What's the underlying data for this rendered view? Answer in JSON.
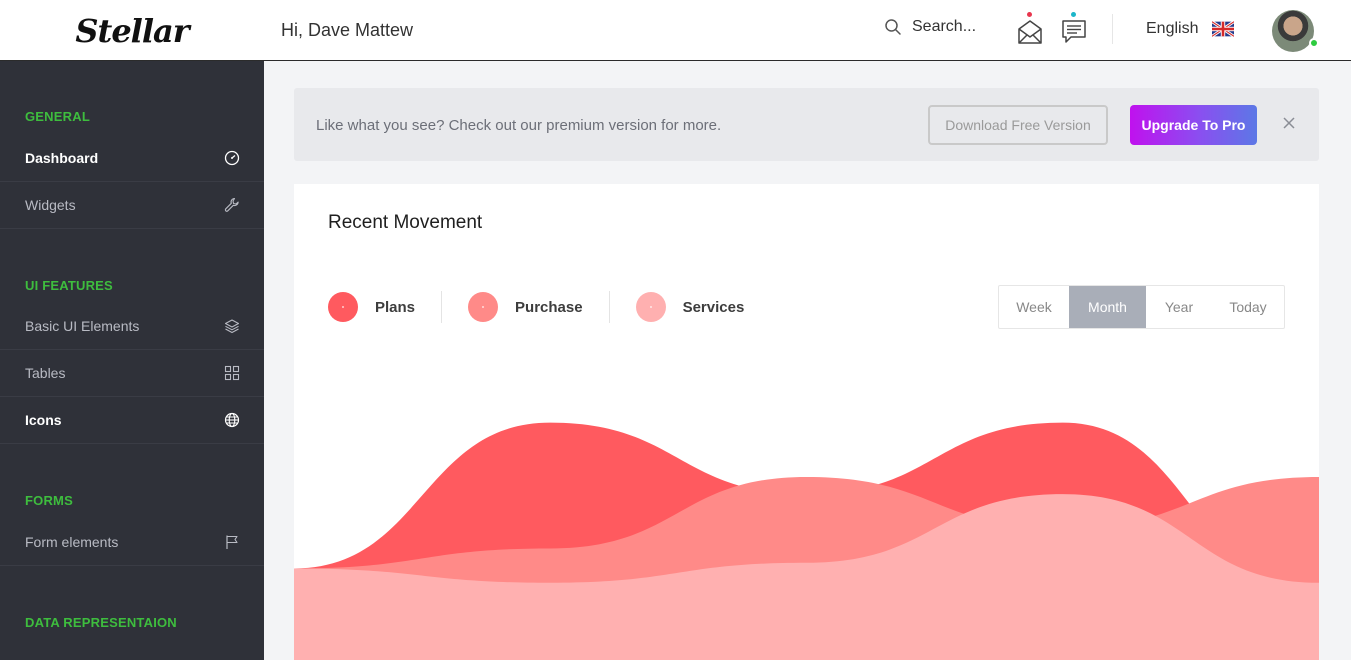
{
  "brand": {
    "name": "Stellar"
  },
  "header": {
    "greeting": "Hi, Dave Mattew",
    "search_placeholder": "Search...",
    "language": "English",
    "mail_dot_color": "#e8364e",
    "chat_dot_color": "#1cb6c9"
  },
  "sidebar": {
    "sections": [
      {
        "title": "GENERAL",
        "items": [
          {
            "label": "Dashboard",
            "icon": "speedometer-icon",
            "active": true
          },
          {
            "label": "Widgets",
            "icon": "wrench-icon",
            "active": false
          }
        ]
      },
      {
        "title": "UI FEATURES",
        "items": [
          {
            "label": "Basic UI Elements",
            "icon": "layers-icon",
            "active": false
          },
          {
            "label": "Tables",
            "icon": "grid-icon",
            "active": false
          },
          {
            "label": "Icons",
            "icon": "globe-icon",
            "active": true
          }
        ]
      },
      {
        "title": "FORMS",
        "items": [
          {
            "label": "Form elements",
            "icon": "flag-icon",
            "active": false
          }
        ]
      },
      {
        "title": "DATA REPRESENTAION",
        "items": []
      }
    ]
  },
  "banner": {
    "text": "Like what you see? Check out our premium version for more.",
    "download_label": "Download Free Version",
    "upgrade_label": "Upgrade To Pro"
  },
  "card": {
    "title": "Recent Movement",
    "legend": [
      {
        "label": "Plans",
        "color": "#ff5a5f"
      },
      {
        "label": "Purchase",
        "color": "#ff8a88"
      },
      {
        "label": "Services",
        "color": "#ffb0b0"
      }
    ],
    "periods": [
      "Week",
      "Month",
      "Year",
      "Today"
    ],
    "selected_period": "Month"
  },
  "chart_data": {
    "type": "area",
    "smooth": true,
    "stacked": false,
    "axes_visible": false,
    "grid": false,
    "title": "",
    "x": [
      0,
      1,
      2,
      3,
      4
    ],
    "ylim": [
      0,
      100
    ],
    "series": [
      {
        "name": "Plans",
        "color": "#ff5a5f",
        "values": [
          32,
          83,
          58,
          83,
          25
        ]
      },
      {
        "name": "Purchase",
        "color": "#ff8a88",
        "values": [
          32,
          39,
          64,
          46,
          64
        ]
      },
      {
        "name": "Services",
        "color": "#ffb0b0",
        "values": [
          32,
          27,
          34,
          58,
          27
        ]
      }
    ]
  }
}
